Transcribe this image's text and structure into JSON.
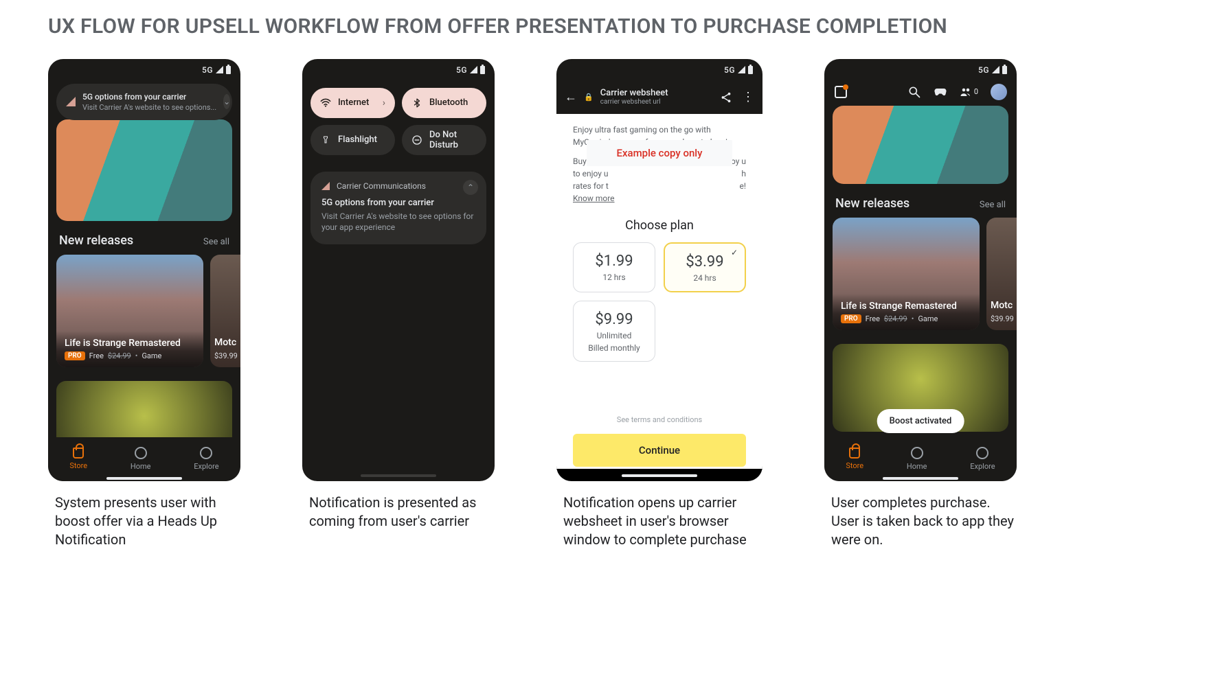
{
  "page_title": "UX FLOW FOR UPSELL WORKFLOW FROM OFFER PRESENTATION TO PURCHASE COMPLETION",
  "status": {
    "network": "5G"
  },
  "captions": {
    "s1": "System presents user with boost offer via a Heads Up Notification",
    "s2": "Notification is presented as coming from user's carrier",
    "s3": "Notification opens up carrier websheet in user's browser window to complete purchase",
    "s4": "User completes purchase. User is taken back to app they were on."
  },
  "hun": {
    "title": "5G options from your carrier",
    "subtitle": "Visit Carrier A's website to see options..."
  },
  "store": {
    "section_title": "New releases",
    "see_all": "See all",
    "card1": {
      "title": "Life is Strange Remastered",
      "badge": "PRO",
      "free": "Free",
      "strike": "$24.99",
      "category": "Game"
    },
    "card2": {
      "title": "Motc",
      "price": "$39.99"
    },
    "nav": {
      "store": "Store",
      "home": "Home",
      "explore": "Explore"
    }
  },
  "qs": {
    "internet": "Internet",
    "bluetooth": "Bluetooth",
    "flashlight": "Flashlight",
    "dnd": "Do Not Disturb"
  },
  "notif": {
    "app": "Carrier Communications",
    "title": "5G options from your carrier",
    "body": "Visit Carrier A's website to see options for your app experience"
  },
  "websheet": {
    "title": "Carrier websheet",
    "url": "carrier websheet url",
    "copy1": "Enjoy ultra fast gaming on the go with MyCarrier's new performance boost plans!",
    "copy2_a": "Buy a pas",
    "copy2_b": "plan to enjoy u",
    "copy2_c": "rates for t",
    "know_more": "Know more",
    "example_only": "Example copy only",
    "choose": "Choose plan",
    "plans": [
      {
        "price": "$1.99",
        "sub": "12 hrs",
        "selected": false
      },
      {
        "price": "$3.99",
        "sub": "24 hrs",
        "selected": true
      },
      {
        "price": "$9.99",
        "sub": "Unlimited",
        "sub2": "Billed monthly",
        "selected": false
      }
    ],
    "terms": "See terms and conditions",
    "continue": "Continue"
  },
  "s4": {
    "friends_count": "0",
    "toast": "Boost activated"
  }
}
